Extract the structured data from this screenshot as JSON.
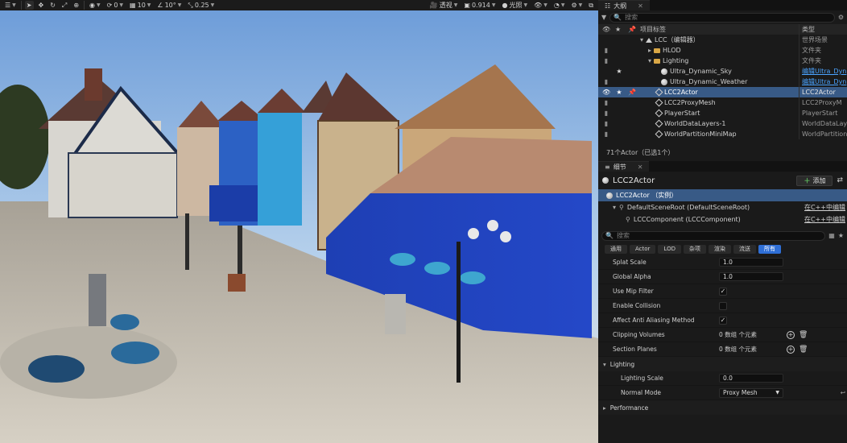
{
  "toolbar": {
    "snap_rotate": "0",
    "snap_grid": "10",
    "snap_angle": "10°",
    "snap_scale": "0.25",
    "view_mode": "透视",
    "camera_speed": "0.914",
    "lit_mode": "光照"
  },
  "outliner": {
    "tab_title": "大纲",
    "search_placeholder": "搜索",
    "col_label": "项目标签",
    "col_type": "类型",
    "rows": [
      {
        "label": "LCC（编辑器）",
        "type": "世界场景"
      },
      {
        "label": "HLOD",
        "type": "文件夹"
      },
      {
        "label": "Lighting",
        "type": "文件夹"
      },
      {
        "label": "Ultra_Dynamic_Sky",
        "type": "编辑Ultra_Dyn"
      },
      {
        "label": "Ultra_Dynamic_Weather",
        "type": "编辑Ultra_Dyn"
      },
      {
        "label": "LCC2Actor",
        "type": "LCC2Actor"
      },
      {
        "label": "LCC2ProxyMesh",
        "type": "LCC2ProxyM"
      },
      {
        "label": "PlayerStart",
        "type": "PlayerStart"
      },
      {
        "label": "WorldDataLayers-1",
        "type": "WorldDataLay"
      },
      {
        "label": "WorldPartitionMiniMap",
        "type": "WorldPartition"
      }
    ],
    "status": "71个Actor（已选1个）"
  },
  "details": {
    "tab_title": "细节",
    "actor_name": "LCC2Actor",
    "add_label": "添加",
    "instance_label": "LCC2Actor （实例）",
    "root_label": "DefaultSceneRoot (DefaultSceneRoot)",
    "root_link": "在C++中编辑",
    "comp_label": "LCCComponent (LCCComponent)",
    "comp_link": "在C++中编辑",
    "search_placeholder": "搜索",
    "filters": [
      "通用",
      "Actor",
      "LOD",
      "杂项",
      "渲染",
      "流送",
      "所有"
    ],
    "props": {
      "splat_scale_label": "Splat Scale",
      "splat_scale_value": "1.0",
      "global_alpha_label": "Global Alpha",
      "global_alpha_value": "1.0",
      "mip_filter_label": "Use Mip Filter",
      "collision_label": "Enable Collision",
      "aa_label": "Affect Anti Aliasing Method",
      "clipping_label": "Clipping Volumes",
      "clipping_value": "0 数组 个元素",
      "section_label": "Section Planes",
      "section_value": "0 数组 个元素"
    },
    "lighting_category": "Lighting",
    "lighting_scale_label": "Lighting Scale",
    "lighting_scale_value": "0.0",
    "normal_mode_label": "Normal Mode",
    "normal_mode_value": "Proxy Mesh",
    "performance_category": "Performance"
  },
  "colors": {
    "selection": "#385a86",
    "accent_blue": "#2f6fd6",
    "link_blue": "#4aa3ff"
  }
}
